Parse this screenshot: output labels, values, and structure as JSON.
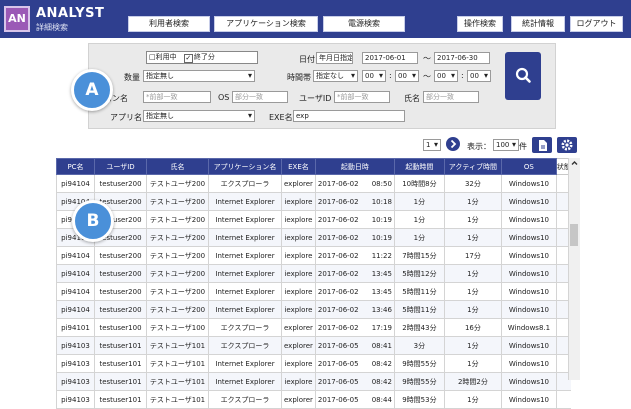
{
  "app": {
    "logo": "AN",
    "title": "ANALYST",
    "subtitle": "詳細検索"
  },
  "nav": [
    "利用者検索",
    "アプリケーション検索",
    "電源検索",
    "操作検索",
    "統計情報",
    "ログアウト"
  ],
  "filters": {
    "status_in_use": "□利用中",
    "status_finished": "終了分",
    "date_label": "日付",
    "date_mode": "年月日指定",
    "date_from": "2017-06-01",
    "date_to": "2017-06-30",
    "count_label": "数量",
    "count_value": "指定無し",
    "time_label": "時間帯",
    "time_mode": "指定なし",
    "hour_from": "00",
    "min_from": "00",
    "hour_to": "00",
    "min_to": "00",
    "pc_label": "コン名",
    "pc_placeholder": "*前部一致",
    "os_label": "OS",
    "os_placeholder": "部分一致",
    "user_label": "ユーザID",
    "user_placeholder": "*前部一致",
    "name_label": "氏名",
    "name_placeholder": "部分一致",
    "app_label": "アプリ名",
    "app_value": "指定無し",
    "exe_label": "EXE名",
    "exe_value": "exp",
    "tilde": "～",
    "colon": ":"
  },
  "pager": {
    "page": "1",
    "display_label": "表示：",
    "per_page": "100",
    "unit": "件"
  },
  "callouts": {
    "a": "A",
    "b": "B"
  },
  "table": {
    "headers": [
      "PC名",
      "ユーザID",
      "氏名",
      "アプリケーション名",
      "EXE名",
      "起動日時",
      "起動時間",
      "アクティブ時間",
      "OS",
      "状態"
    ],
    "rows": [
      [
        "pi94104",
        "testuser200",
        "テストユーザ200",
        "エクスプローラ",
        "explorer",
        "2017-06-02",
        "08:50",
        "10時間8分",
        "32分",
        "Windows10"
      ],
      [
        "pi94104",
        "testuser200",
        "テストユーザ200",
        "Internet Explorer",
        "iexplore",
        "2017-06-02",
        "10:18",
        "1分",
        "1分",
        "Windows10"
      ],
      [
        "pi94104",
        "testuser200",
        "テストユーザ200",
        "Internet Explorer",
        "iexplore",
        "2017-06-02",
        "10:19",
        "1分",
        "1分",
        "Windows10"
      ],
      [
        "pi94104",
        "testuser200",
        "テストユーザ200",
        "Internet Explorer",
        "iexplore",
        "2017-06-02",
        "10:19",
        "1分",
        "1分",
        "Windows10"
      ],
      [
        "pi94104",
        "testuser200",
        "テストユーザ200",
        "Internet Explorer",
        "iexplore",
        "2017-06-02",
        "11:22",
        "7時間15分",
        "17分",
        "Windows10"
      ],
      [
        "pi94104",
        "testuser200",
        "テストユーザ200",
        "Internet Explorer",
        "iexplore",
        "2017-06-02",
        "13:45",
        "5時間12分",
        "1分",
        "Windows10"
      ],
      [
        "pi94104",
        "testuser200",
        "テストユーザ200",
        "Internet Explorer",
        "iexplore",
        "2017-06-02",
        "13:45",
        "5時間11分",
        "1分",
        "Windows10"
      ],
      [
        "pi94104",
        "testuser200",
        "テストユーザ200",
        "Internet Explorer",
        "iexplore",
        "2017-06-02",
        "13:46",
        "5時間11分",
        "1分",
        "Windows10"
      ],
      [
        "pi94101",
        "testuser100",
        "テストユーザ100",
        "エクスプローラ",
        "explorer",
        "2017-06-02",
        "17:19",
        "2時間43分",
        "16分",
        "Windows8.1"
      ],
      [
        "pi94103",
        "testuser101",
        "テストユーザ101",
        "エクスプローラ",
        "explorer",
        "2017-06-05",
        "08:41",
        "3分",
        "1分",
        "Windows10"
      ],
      [
        "pi94103",
        "testuser101",
        "テストユーザ101",
        "Internet Explorer",
        "iexplore",
        "2017-06-05",
        "08:42",
        "9時間55分",
        "1分",
        "Windows10"
      ],
      [
        "pi94103",
        "testuser101",
        "テストユーザ101",
        "Internet Explorer",
        "iexplore",
        "2017-06-05",
        "08:42",
        "9時間55分",
        "2時間2分",
        "Windows10"
      ],
      [
        "pi94103",
        "testuser101",
        "テストユーザ101",
        "エクスプローラ",
        "explorer",
        "2017-06-05",
        "08:44",
        "9時間53分",
        "1分",
        "Windows10"
      ]
    ]
  }
}
